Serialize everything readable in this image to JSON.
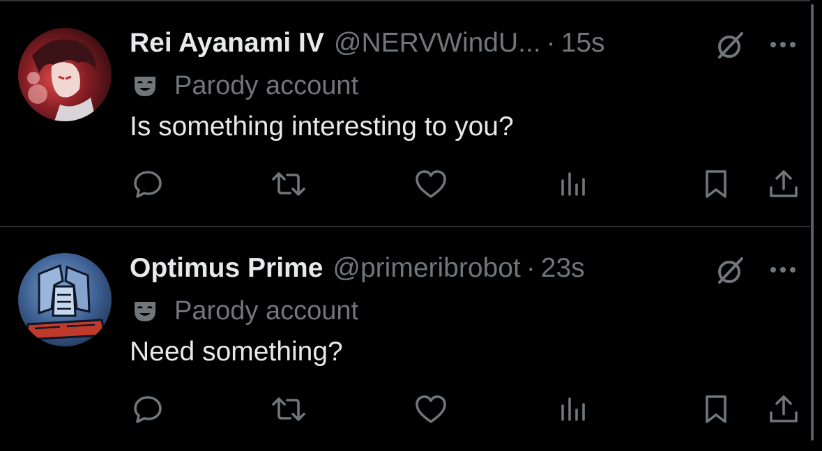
{
  "colors": {
    "background": "#000000",
    "primary_text": "#e7e9ea",
    "secondary_text": "#71767b",
    "divider": "#2f3336"
  },
  "tweets": [
    {
      "display_name": "Rei Ayanami IV",
      "handle": "@NERVWindU...",
      "separator": "·",
      "time": "15s",
      "label": "Parody account",
      "label_icon": "mask-icon",
      "text": "Is something interesting to you?",
      "avatar": "anime-girl-red-avatar",
      "actions": [
        "reply-icon",
        "retweet-icon",
        "like-icon",
        "views-icon",
        "bookmark-icon",
        "share-icon"
      ]
    },
    {
      "display_name": "Optimus Prime",
      "handle": "@primeribrobot",
      "separator": "·",
      "time": "23s",
      "label": "Parody account",
      "label_icon": "mask-icon",
      "text": "Need something?",
      "avatar": "robot-blue-avatar",
      "actions": [
        "reply-icon",
        "retweet-icon",
        "like-icon",
        "views-icon",
        "bookmark-icon",
        "share-icon"
      ]
    }
  ]
}
